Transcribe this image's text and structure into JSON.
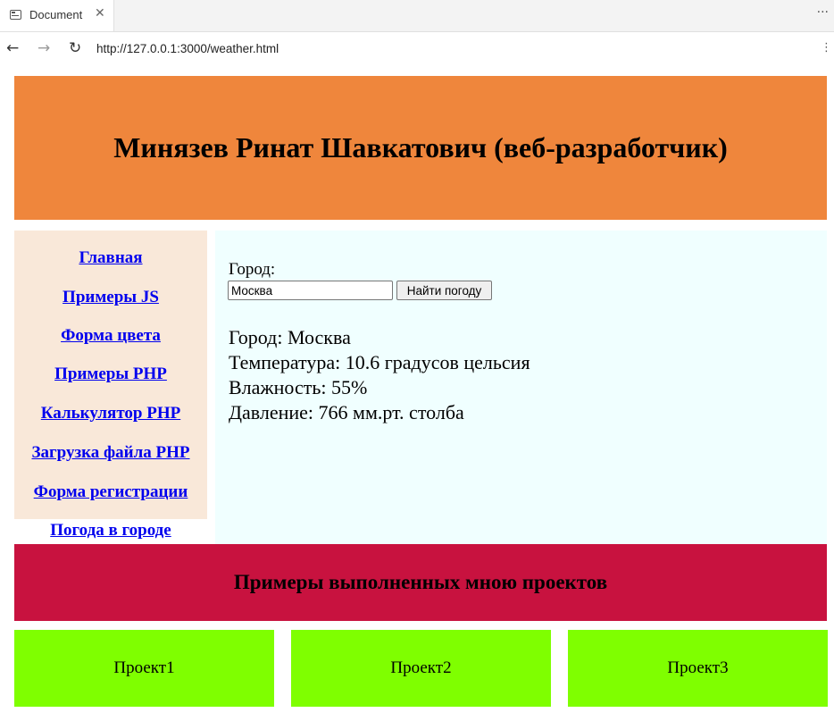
{
  "browser": {
    "tab_title": "Document",
    "tab_close_glyph": "✕",
    "more_glyph": "···",
    "url": "http://127.0.0.1:3000/weather.html",
    "back_glyph": "←",
    "forward_glyph": "→",
    "reload_glyph": "↻",
    "menu_glyph": "⋮"
  },
  "header": {
    "title": "Минязев Ринат Шавкатович (веб-разработчик)",
    "background": "#ef863c"
  },
  "sidebar": {
    "background": "#f9e8d9",
    "items": [
      {
        "label": "Главная"
      },
      {
        "label": "Примеры JS"
      },
      {
        "label": "Форма цвета"
      },
      {
        "label": "Примеры PHP"
      },
      {
        "label": "Калькулятор PHP"
      },
      {
        "label": "Загрузка файла PHP"
      },
      {
        "label": "Форма регистрации"
      },
      {
        "label": "Погода в городе"
      }
    ]
  },
  "weather": {
    "city_label": "Город:",
    "city_value": "Москва",
    "button_label": "Найти погоду",
    "result": {
      "city": "Город: Москва",
      "temperature": "Температура: 10.6 градусов цельсия",
      "humidity": "Влажность: 55%",
      "pressure": "Давление: 766 мм.рт. столба"
    },
    "background": "#f0ffff"
  },
  "projects": {
    "title": "Примеры выполненных мною проектов",
    "banner_color": "#c8123f",
    "card_color": "#7fff00",
    "items": [
      {
        "label": "Проект1"
      },
      {
        "label": "Проект2"
      },
      {
        "label": "Проект3"
      }
    ]
  }
}
